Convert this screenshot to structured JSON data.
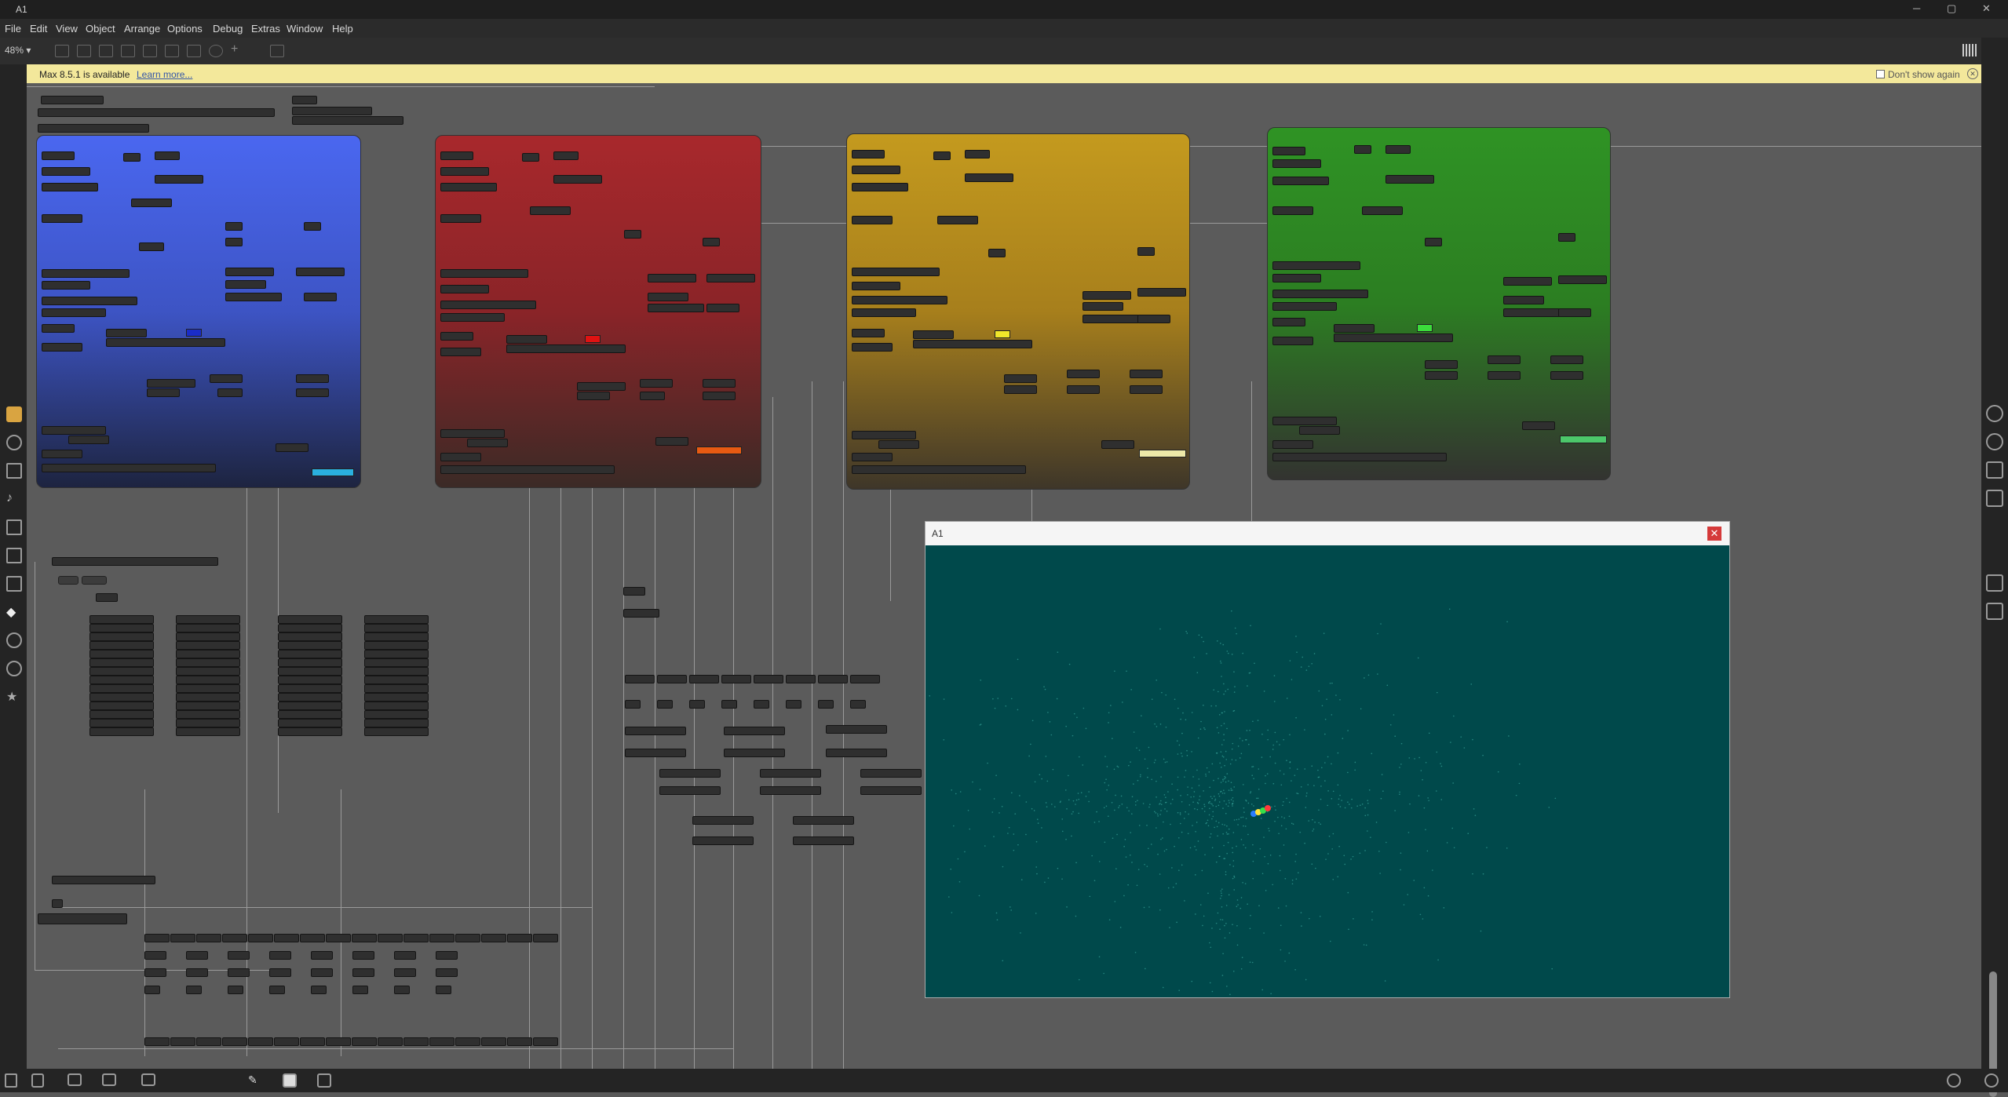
{
  "window": {
    "title": "A1",
    "minimize": "─",
    "maximize": "▢",
    "close": "✕"
  },
  "menu": [
    "File",
    "Edit",
    "View",
    "Object",
    "Arrange",
    "Options",
    "Debug",
    "Extras",
    "Window",
    "Help"
  ],
  "toolbar": {
    "zoom": "48% ▾"
  },
  "notice": {
    "text": "Max 8.5.1 is available",
    "link": "Learn more...",
    "dont_show": "Don't show again"
  },
  "viewer": {
    "title": "A1",
    "close": "✕"
  },
  "colors": {
    "blue": "#4a67f0",
    "red": "#a8282c",
    "yellow": "#c49a1e",
    "green": "#2f9324",
    "gl_bg": "#00494b"
  },
  "icons": {
    "search": "search-icon",
    "info": "info-icon",
    "book": "book-icon",
    "lock": "lock-icon",
    "grid": "grid-icon"
  }
}
